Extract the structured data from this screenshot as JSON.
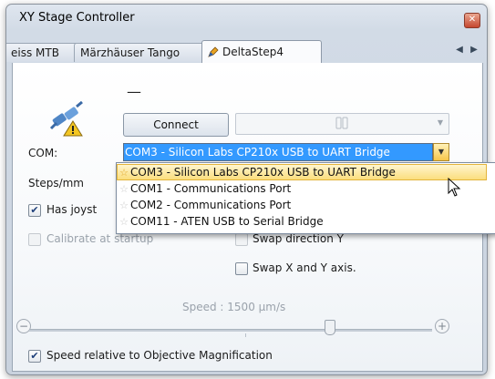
{
  "window": {
    "title": "XY Stage Controller",
    "close_glyph": "✕"
  },
  "tabs": {
    "items": [
      "eiss MTB",
      "Märzhäuser Tango",
      "DeltaStep4"
    ],
    "active_index": 2,
    "scroll_left": "◀",
    "scroll_right": "▶"
  },
  "connection": {
    "status_text": "—",
    "connect_label": "Connect",
    "device_combo_value": ""
  },
  "com": {
    "label": "COM:",
    "selected": "COM3 - Silicon Labs CP210x USB to UART Bridge",
    "options": [
      "COM3 - Silicon Labs CP210x USB to UART Bridge",
      "COM1 - Communications Port",
      "COM2 - Communications Port",
      "COM11 - ATEN USB to Serial Bridge"
    ],
    "highlighted_index": 0
  },
  "settings": {
    "steps_label": "Steps/mm",
    "has_joystick_label": "Has joyst",
    "has_joystick_checked": true,
    "calibrate_label": "Calibrate at startup",
    "calibrate_checked": false,
    "swap_y_label": "Swap direction Y",
    "swap_xy_label": "Swap X and Y axis.",
    "swap_xy_checked": false
  },
  "speed": {
    "label": "Speed : 1500 µm/s",
    "minus_glyph": "−",
    "plus_glyph": "+",
    "relative_label": "Speed relative to Objective Magnification",
    "relative_checked": true
  },
  "colors": {
    "selection_blue": "#3399ff",
    "highlight_gold": "#fbde7d"
  }
}
